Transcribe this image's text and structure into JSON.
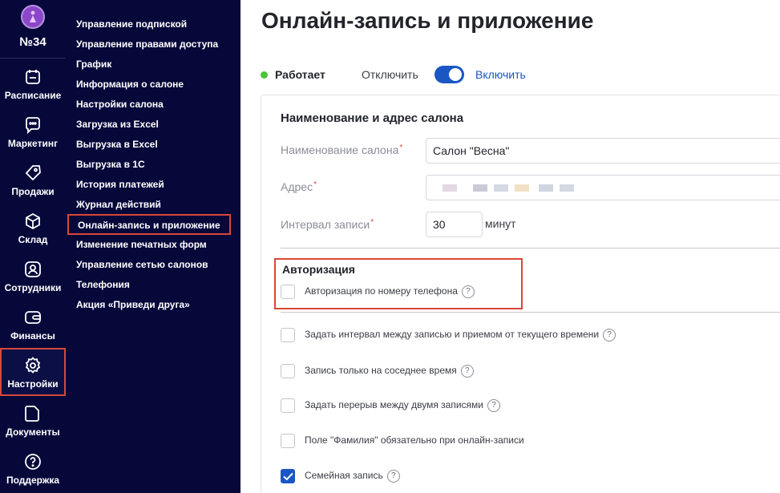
{
  "rail": {
    "number": "№34",
    "items": [
      {
        "label": "Расписание",
        "icon": "calendar-icon"
      },
      {
        "label": "Маркетинг",
        "icon": "chat-icon"
      },
      {
        "label": "Продажи",
        "icon": "tag-icon"
      },
      {
        "label": "Склад",
        "icon": "box-icon"
      },
      {
        "label": "Сотрудники",
        "icon": "user-icon"
      },
      {
        "label": "Финансы",
        "icon": "wallet-icon"
      },
      {
        "label": "Настройки",
        "icon": "gear-icon"
      },
      {
        "label": "Документы",
        "icon": "document-icon"
      },
      {
        "label": "Поддержка",
        "icon": "help-icon"
      }
    ]
  },
  "submenu": {
    "items": [
      "Управление подпиской",
      "Управление правами доступа",
      "График",
      "Информация о салоне",
      "Настройки салона",
      "Загрузка из Excel",
      "Выгрузка в Excel",
      "Выгрузка в 1С",
      "История платежей",
      "Журнал действий",
      "Онлайн-запись и приложение",
      "Изменение печатных форм",
      "Управление сетью салонов",
      "Телефония",
      "Акция «Приведи друга»"
    ]
  },
  "page": {
    "title": "Онлайн-запись и приложение",
    "status": "Работает",
    "off_label": "Отключить",
    "on_label": "Включить"
  },
  "form": {
    "section_title": "Наименование и адрес салона",
    "name_label": "Наименование салона",
    "name_value": "Салон \"Весна\"",
    "address_label": "Адрес",
    "interval_label": "Интервал записи",
    "interval_value": "30",
    "interval_unit": "минут",
    "auth_title": "Авторизация",
    "req_mark": "*",
    "help_mark": "?"
  },
  "options": [
    {
      "label": "Авторизация по номеру телефона",
      "checked": false,
      "help": true
    },
    {
      "label": "Задать интервал между записью и приемом от текущего времени",
      "checked": false,
      "help": true
    },
    {
      "label": "Запись только на соседнее время",
      "checked": false,
      "help": true
    },
    {
      "label": "Задать перерыв между двумя записями",
      "checked": false,
      "help": true
    },
    {
      "label": "Поле \"Фамилия\" обязательно при онлайн-записи",
      "checked": false,
      "help": false
    },
    {
      "label": "Семейная запись",
      "checked": true,
      "help": true
    }
  ],
  "colors": {
    "sidebar_bg": "#06083a",
    "accent_blue": "#1a56c4",
    "highlight_red": "#d8473a",
    "status_green": "#4cc23a"
  }
}
